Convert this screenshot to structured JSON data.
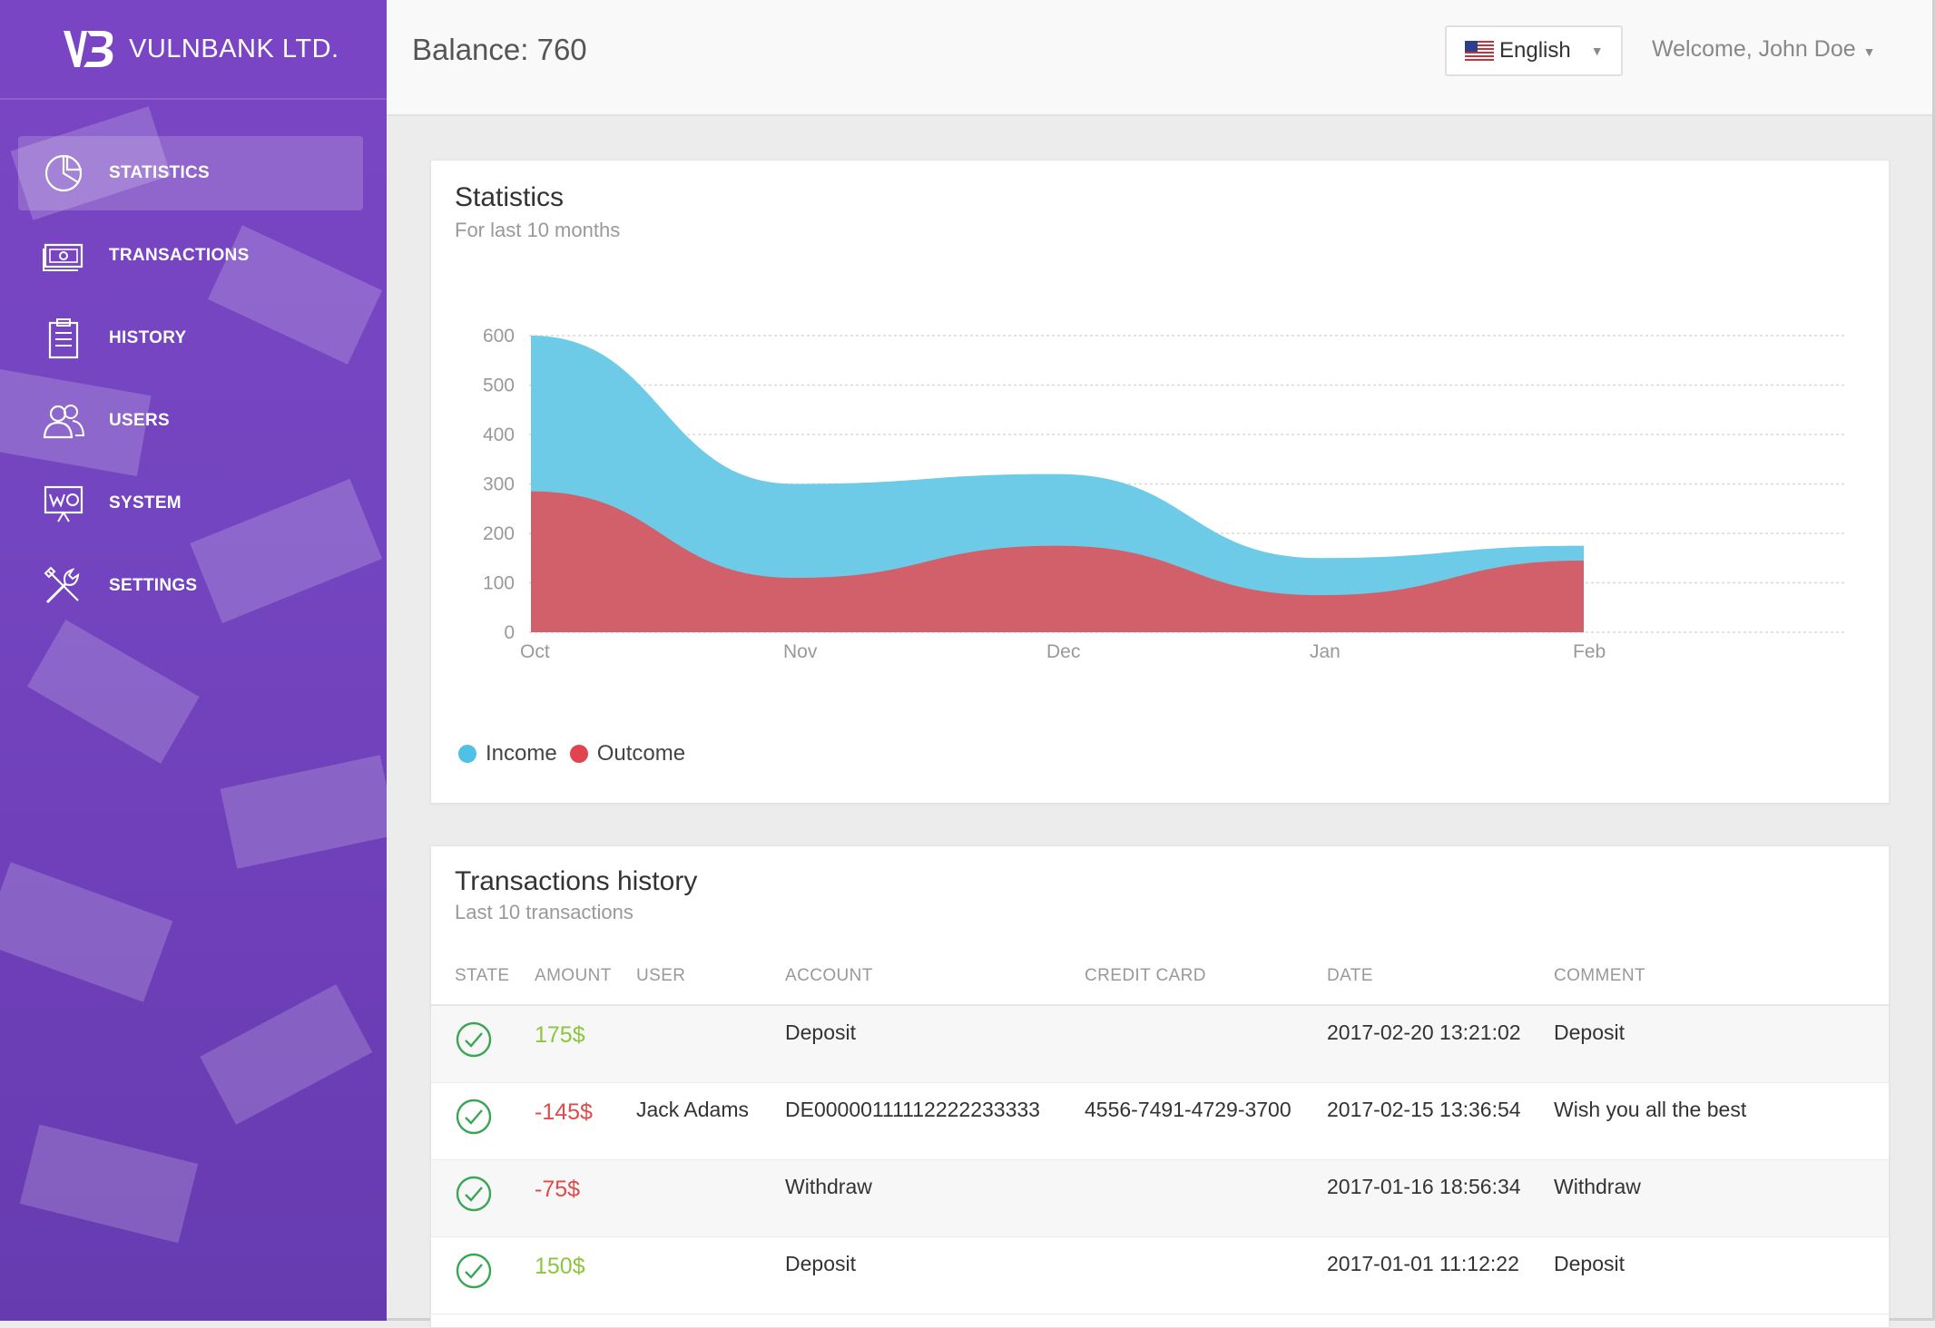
{
  "brand": {
    "name": "VULNBANK LTD."
  },
  "sidebar": {
    "items": [
      {
        "label": "STATISTICS",
        "icon": "pie-chart-icon",
        "active": true
      },
      {
        "label": "TRANSACTIONS",
        "icon": "banknote-icon",
        "active": false
      },
      {
        "label": "HISTORY",
        "icon": "clipboard-icon",
        "active": false
      },
      {
        "label": "USERS",
        "icon": "users-icon",
        "active": false
      },
      {
        "label": "SYSTEM",
        "icon": "presentation-board-icon",
        "active": false
      },
      {
        "label": "SETTINGS",
        "icon": "tools-icon",
        "active": false
      }
    ]
  },
  "header": {
    "balance": "Balance: 760",
    "language": "English",
    "welcome": "Welcome, John Doe"
  },
  "statistics": {
    "title": "Statistics",
    "subtitle": "For last 10 months"
  },
  "chart_data": {
    "type": "area",
    "categories": [
      "Oct",
      "Nov",
      "Dec",
      "Jan",
      "Feb"
    ],
    "series": [
      {
        "name": "Income",
        "color": "#6dcbe8",
        "values": [
          600,
          300,
          320,
          150,
          175
        ]
      },
      {
        "name": "Outcome",
        "color": "#d2606b",
        "values": [
          285,
          110,
          175,
          75,
          145
        ]
      }
    ],
    "ylim": [
      0,
      600
    ],
    "yticks": [
      "0",
      "100",
      "200",
      "300",
      "400",
      "500",
      "600"
    ],
    "grid": true,
    "legend_position": "bottom-left"
  },
  "history": {
    "title": "Transactions history",
    "subtitle": "Last 10 transactions",
    "columns": [
      "STATE",
      "AMOUNT",
      "USER",
      "ACCOUNT",
      "CREDIT CARD",
      "DATE",
      "COMMENT"
    ],
    "rows": [
      {
        "amount": "175$",
        "type": "positive",
        "user": "",
        "account": "Deposit",
        "card": "",
        "date": "2017-02-20 13:21:02",
        "comment": "Deposit"
      },
      {
        "amount": "-145$",
        "type": "negative",
        "user": "Jack Adams",
        "account": "DE00000111112222233333",
        "card": "4556-7491-4729-3700",
        "date": "2017-02-15 13:36:54",
        "comment": "Wish you all the best"
      },
      {
        "amount": "-75$",
        "type": "negative",
        "user": "",
        "account": "Withdraw",
        "card": "",
        "date": "2017-01-16 18:56:34",
        "comment": "Withdraw"
      },
      {
        "amount": "150$",
        "type": "positive",
        "user": "",
        "account": "Deposit",
        "card": "",
        "date": "2017-01-01 11:12:22",
        "comment": "Deposit"
      }
    ]
  },
  "colors": {
    "sidebar": "#7445c0",
    "income": "#6dcbe8",
    "outcome": "#d2606b",
    "positive": "#8cc63f",
    "negative": "#e04a4a"
  }
}
